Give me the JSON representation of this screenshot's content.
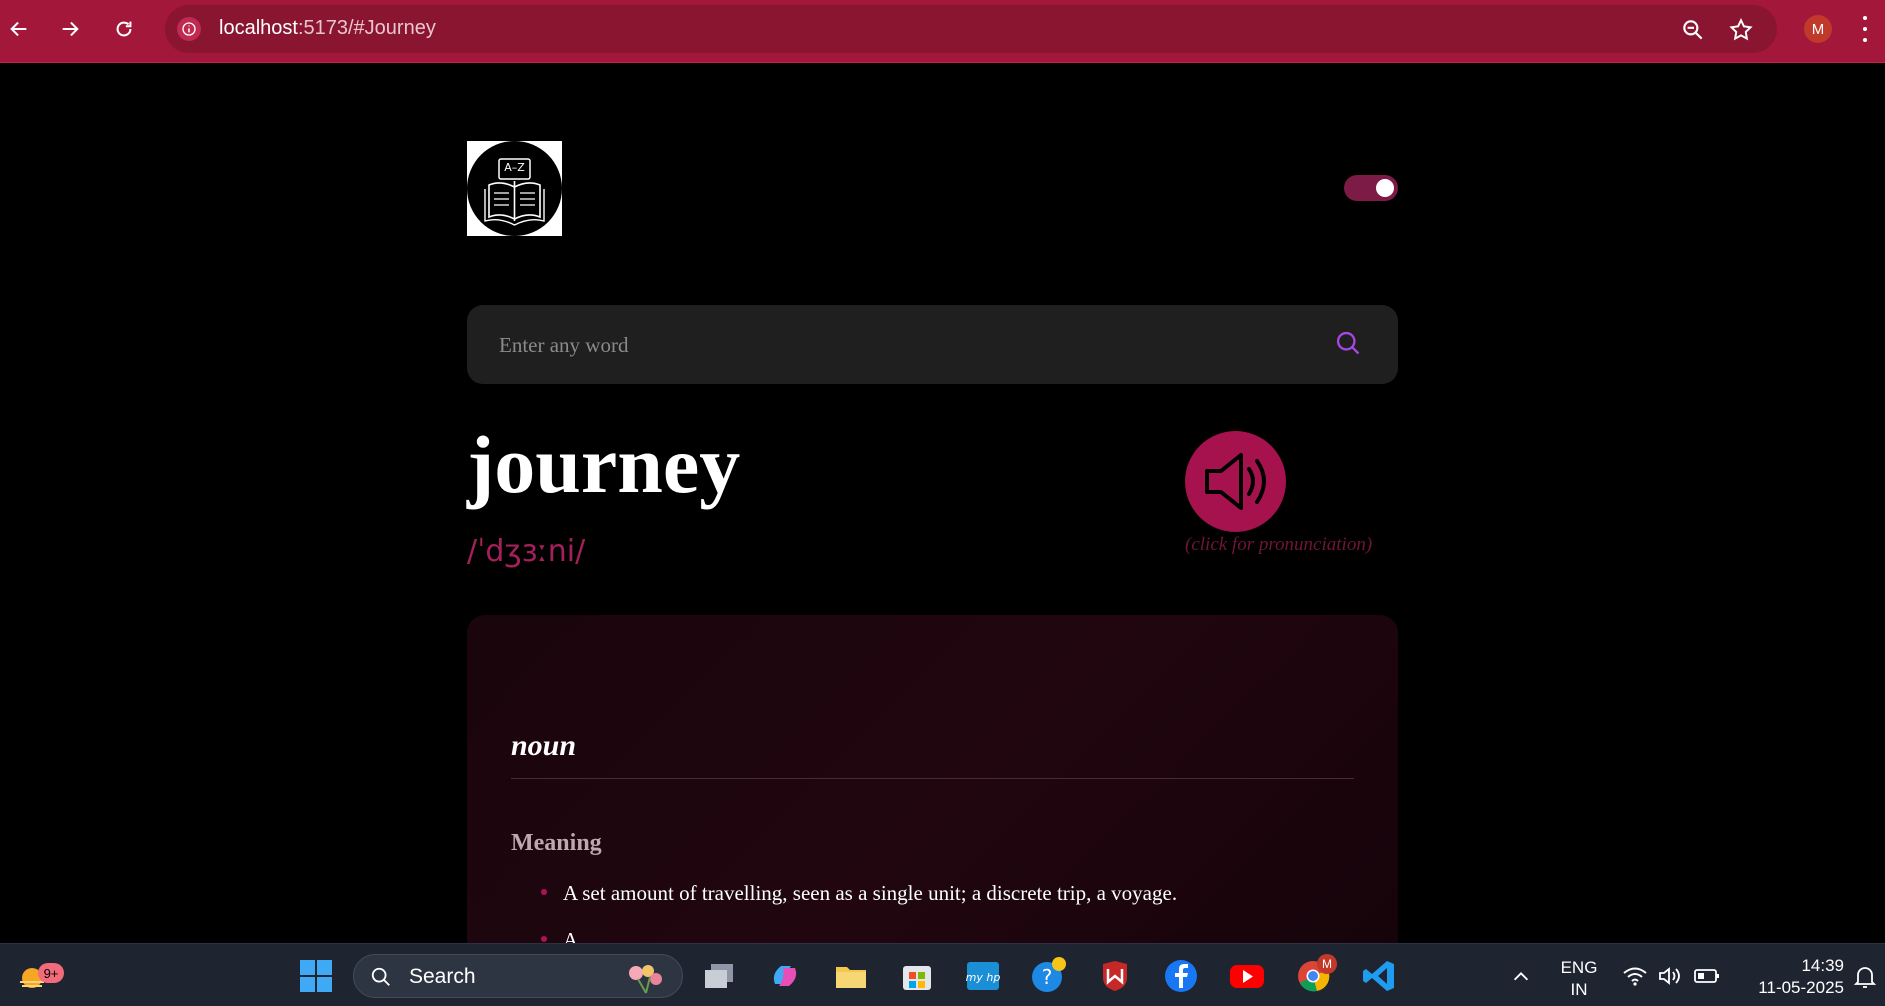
{
  "browser": {
    "url_host": "localhost",
    "url_rest": ":5173/#Journey",
    "avatar_letter": "M",
    "accent": "#a3173b"
  },
  "app": {
    "logo_text": "A–Z",
    "search_placeholder": "Enter any word",
    "theme_toggle_on": true
  },
  "entry": {
    "word": "journey",
    "phonetic": "/ˈdʒɜːni/",
    "pronunciation_hint": "(click for pronunciation)",
    "part_of_speech": "noun",
    "meaning_title": "Meaning",
    "definitions": [
      "A set amount of travelling, seen as a single unit; a discrete trip, a voyage.",
      "A"
    ]
  },
  "taskbar": {
    "weather_badge": "9+",
    "search_label": "Search",
    "lang_line1": "ENG",
    "lang_line2": "IN",
    "time": "14:39",
    "date": "11-05-2025",
    "chrome_badge": "M"
  }
}
